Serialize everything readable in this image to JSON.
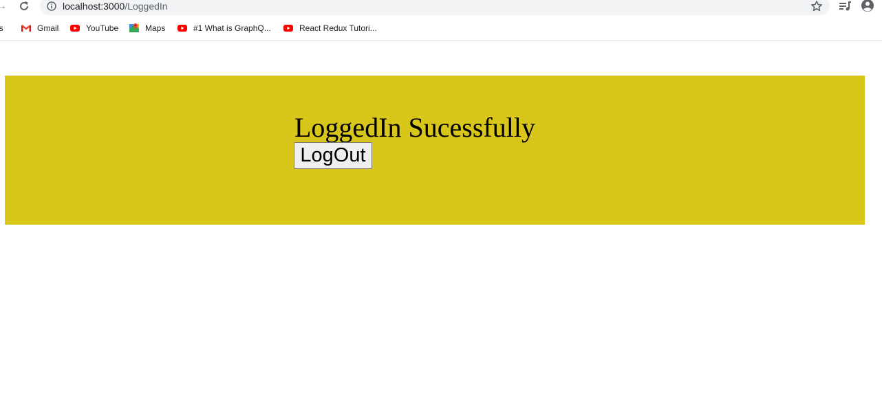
{
  "browser": {
    "url_host": "localhost:3000",
    "url_path": "/LoggedIn",
    "bookmarks": [
      {
        "label": "ps",
        "icon": "apps-icon"
      },
      {
        "label": "Gmail",
        "icon": "gmail-icon"
      },
      {
        "label": "YouTube",
        "icon": "youtube-icon"
      },
      {
        "label": "Maps",
        "icon": "maps-icon"
      },
      {
        "label": "#1 What is GraphQ...",
        "icon": "youtube-icon"
      },
      {
        "label": "React Redux Tutori...",
        "icon": "youtube-icon"
      }
    ]
  },
  "page": {
    "title": "LoggedIn Sucessfully",
    "logout_label": "LogOut"
  },
  "colors": {
    "banner_background": "#d9c61a",
    "youtube_red": "#ff0000",
    "gmail_red": "#ea4335"
  }
}
